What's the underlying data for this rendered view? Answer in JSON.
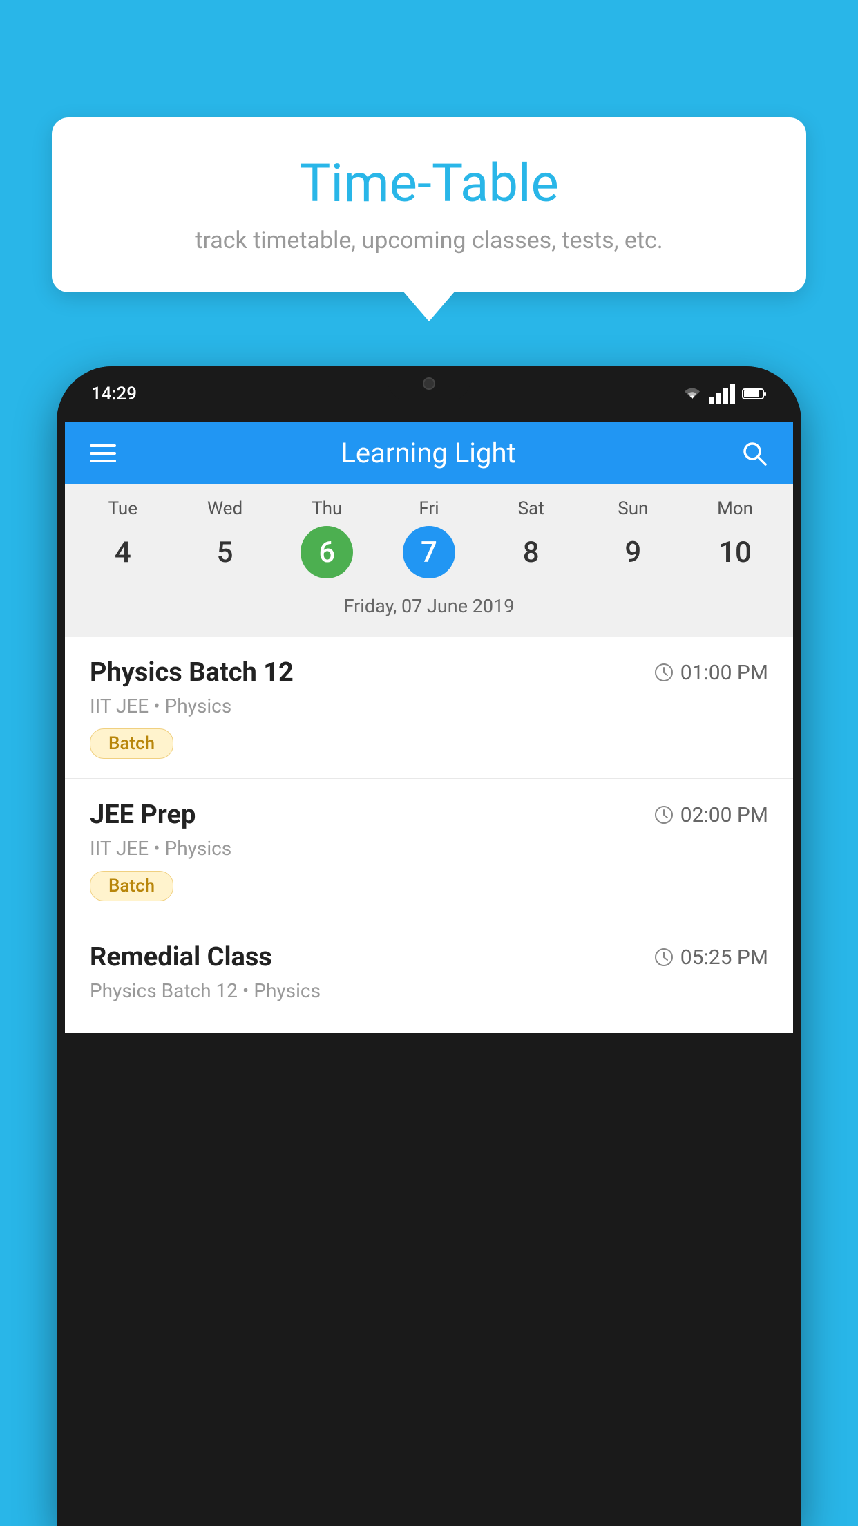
{
  "background_color": "#29b6e8",
  "tooltip": {
    "title": "Time-Table",
    "subtitle": "track timetable, upcoming classes, tests, etc."
  },
  "phone": {
    "status_bar": {
      "time": "14:29"
    },
    "app_header": {
      "title": "Learning Light"
    },
    "calendar": {
      "days": [
        {
          "name": "Tue",
          "number": "4",
          "state": "normal"
        },
        {
          "name": "Wed",
          "number": "5",
          "state": "normal"
        },
        {
          "name": "Thu",
          "number": "6",
          "state": "today"
        },
        {
          "name": "Fri",
          "number": "7",
          "state": "selected"
        },
        {
          "name": "Sat",
          "number": "8",
          "state": "normal"
        },
        {
          "name": "Sun",
          "number": "9",
          "state": "normal"
        },
        {
          "name": "Mon",
          "number": "10",
          "state": "normal"
        }
      ],
      "selected_date_label": "Friday, 07 June 2019"
    },
    "schedule": [
      {
        "title": "Physics Batch 12",
        "time": "01:00 PM",
        "subtitle": "IIT JEE • Physics",
        "tag": "Batch"
      },
      {
        "title": "JEE Prep",
        "time": "02:00 PM",
        "subtitle": "IIT JEE • Physics",
        "tag": "Batch"
      },
      {
        "title": "Remedial Class",
        "time": "05:25 PM",
        "subtitle": "Physics Batch 12 • Physics",
        "tag": ""
      }
    ]
  }
}
